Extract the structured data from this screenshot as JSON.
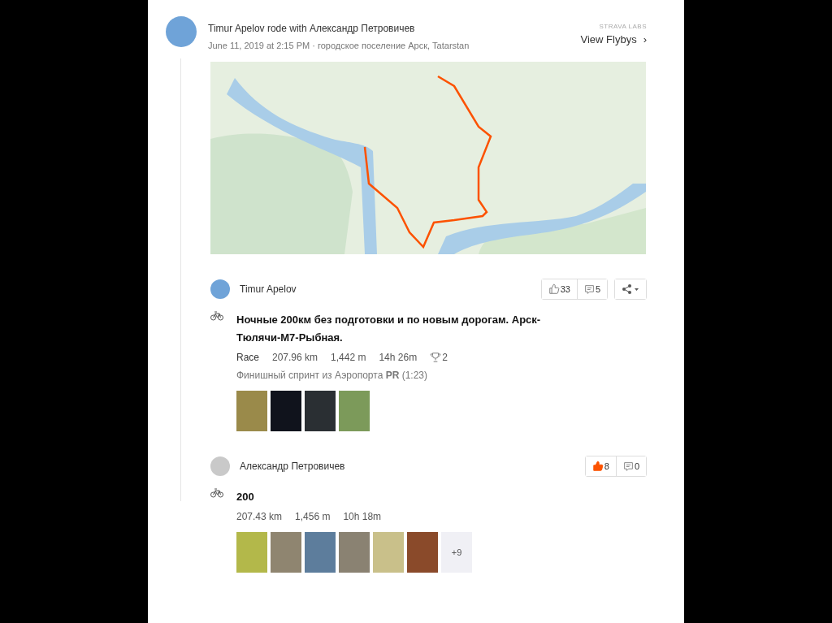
{
  "header": {
    "title": "Timur Apelov rode with Александр Петровичев",
    "meta": "June 11, 2019 at 2:15 PM · городское поселение Арск, Tatarstan",
    "labs_label": "STRAVA LABS",
    "flyby_link": "View Flybys",
    "chevron": "›"
  },
  "activities": [
    {
      "athlete": "Timur Apelov",
      "title": "Ночные 200км без подготовки и по новым дорогам. Арск-Тюлячи-М7-Рыбная.",
      "tag": "Race",
      "stats": [
        "207.96 km",
        "1,442 m",
        "14h 26m"
      ],
      "trophies": "2",
      "note": "Финишный спринт из Аэропорта **PR** (1:23)",
      "kudos": "33",
      "kudos_given": false,
      "comments": "5",
      "share": true,
      "photos": [
        {
          "color": "#9a8a4a"
        },
        {
          "color": "#10131c"
        },
        {
          "color": "#2a2f33"
        },
        {
          "color": "#7c9a5a"
        }
      ]
    },
    {
      "athlete": "Александр Петровичев",
      "title": "200",
      "stats": [
        "207.43 km",
        "1,456 m",
        "10h 18m"
      ],
      "kudos": "8",
      "kudos_given": true,
      "comments": "0",
      "share": false,
      "photos": [
        {
          "color": "#b3b84a"
        },
        {
          "color": "#8f8570"
        },
        {
          "color": "#5d7d9c"
        },
        {
          "color": "#8a8272"
        },
        {
          "color": "#c9c08a"
        },
        {
          "color": "#8a4a2a"
        }
      ],
      "more_photos": "+9"
    }
  ]
}
